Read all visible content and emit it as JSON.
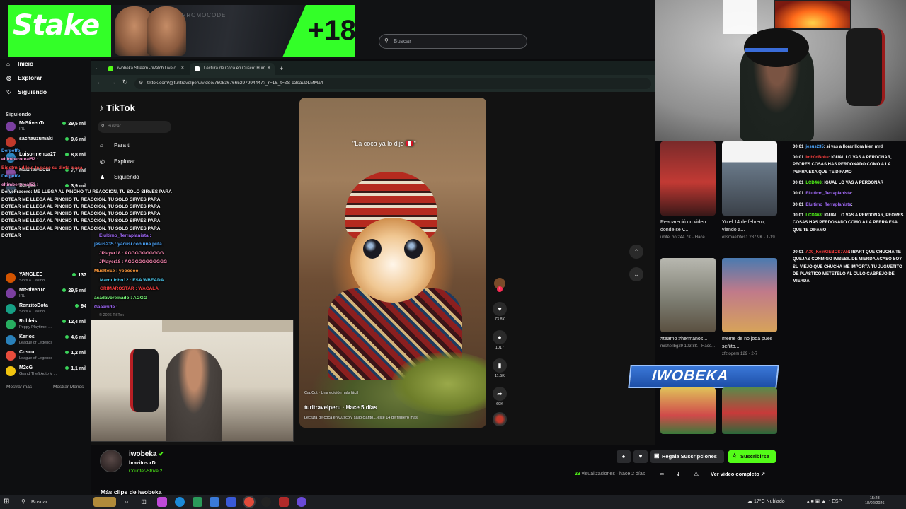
{
  "header": {
    "search_placeholder": "Buscar"
  },
  "banner": {
    "brand": "Stake",
    "promo": "PROMOCODE",
    "age": "+18"
  },
  "sidebar": {
    "nav": [
      "Inicio",
      "Explorar",
      "Siguiendo"
    ],
    "section_title": "Siguiendo",
    "channels": [
      {
        "name": "MrStivenTc",
        "game": "IRL",
        "viewers": "29,5 mil",
        "color": "#7b3fa0"
      },
      {
        "name": "sachauzumaki",
        "game": "",
        "viewers": "9,6 mil",
        "color": "#c0392b"
      },
      {
        "name": "Luisormenoa27",
        "game": "",
        "viewers": "8,8 mil",
        "color": "#2e86c1"
      },
      {
        "name": "MatthewDota",
        "game": "",
        "viewers": "7,7 mil",
        "color": "#884ea0"
      },
      {
        "name": "Bergas",
        "game": "",
        "viewers": "3,9 mil",
        "color": "#34495e"
      },
      {
        "name": "YANGLEE",
        "game": "Slots & Casino",
        "viewers": "137",
        "color": "#d35400"
      },
      {
        "name": "MrStivenTc",
        "game": "IRL",
        "viewers": "29,5 mil",
        "color": "#7b3fa0"
      },
      {
        "name": "RenzitoDota",
        "game": "Slots & Casino",
        "viewers": "94",
        "color": "#16a085"
      },
      {
        "name": "Robleis",
        "game": "Peppy Playtime: ...",
        "viewers": "12,4 mil",
        "color": "#27ae60"
      },
      {
        "name": "Kerios",
        "game": "League of Legends",
        "viewers": "4,6 mil",
        "color": "#2980b9"
      },
      {
        "name": "Coscu",
        "game": "League of Legends",
        "viewers": "1,2 mil",
        "color": "#e74c3c"
      },
      {
        "name": "M2cG",
        "game": "Grand Theft Auto V ...",
        "viewers": "1,1 mil",
        "color": "#f1c40f"
      }
    ],
    "show_more": "Mostrar más",
    "show_less": "Mostrar Menos"
  },
  "overlay_chat": [
    {
      "text": "Derpeffe",
      "color": "#4ea8ff"
    },
    {
      "text": "eltimberoreal52 :",
      "color": "#ff9cd8"
    },
    {
      "text": "Bigetrn : dile q te pase su dieta maca",
      "color": "#ff4a4a"
    },
    {
      "text": "Derpeffe",
      "color": "#4ea8ff"
    },
    {
      "text": "eltimberoreal52 :",
      "color": "#ff9cd8"
    },
    {
      "text": "DeiVeFracero: ME LLEGA AL PINCHO TU REACCION, TU SOLO SIRVES PARA",
      "color": "#ffffff"
    },
    {
      "text": "DOTEAR  ME LLEGA AL PINCHO TU REACCION, TU SOLO SIRVES PARA",
      "color": "#ffffff"
    },
    {
      "text": "DOTEAR  ME LLEGA AL PINCHO TU REACCION, TU SOLO SIRVES PARA",
      "color": "#ffffff"
    },
    {
      "text": "DOTEAR  ME LLEGA AL PINCHO TU REACCION, TU SOLO SIRVES PARA",
      "color": "#ffffff"
    },
    {
      "text": "DOTEAR  ME LLEGA AL PINCHO TU REACCION, TU SOLO SIRVES PARA",
      "color": "#ffffff"
    },
    {
      "text": "DOTEAR  ME LLEGA AL PINCHO TU REACCION, TU SOLO SIRVES PARA",
      "color": "#ffffff"
    },
    {
      "text": "DOTEAR",
      "color": "#ffffff"
    },
    {
      "text": "Elultimo_Terraplanista :",
      "color": "#a66cff"
    },
    {
      "text": "jesus235 : yacusi con una puta",
      "color": "#4ea8ff"
    },
    {
      "text": "JPlayer18 : AGGGGGGGGGG",
      "color": "#ff8ab6"
    },
    {
      "text": "JPlayer18 : AGGGGGGGGGGG",
      "color": "#ff8ab6"
    },
    {
      "text": "MueReEe : yoooooo",
      "color": "#ff9a3c"
    },
    {
      "text": "Marquinho12 : ESA WBEADA",
      "color": "#4ed8ff"
    },
    {
      "text": "GRIMAROSTAR : WACALA",
      "color": "#ff3f3f"
    },
    {
      "text": "acadavoreinado : AGGG",
      "color": "#7cff7c"
    },
    {
      "text": "Gaaanide :",
      "color": "#a66cff"
    }
  ],
  "browser": {
    "tabs": [
      {
        "label": "iwobeka Stream - Watch Live o...",
        "fav": "#53fc18"
      },
      {
        "label": "Lectura de Coca en Cusco: Hum",
        "fav": "#ffffff"
      }
    ],
    "url": "tiktok.com/@turitravelperu/video/7605367665297994447?_r=1&_t=ZS-93sauDLMMa4"
  },
  "tiktok": {
    "logo": "TikTok",
    "search_placeholder": "Buscar",
    "nav": [
      "Para ti",
      "Explorar",
      "Siguiendo"
    ],
    "copyright": "© 2026 TikTok",
    "video": {
      "caption": "\"La coca ya lo dijo 🇵🇪\"",
      "credit": "CapCut · Una edición más fácil",
      "user": "turitravelperu · Hace 5 días",
      "description": "Lectura de coca en Cusco y salió clarito... este 14 de febrero   más"
    },
    "actions": [
      {
        "icon": "♥",
        "count": "73.8K",
        "name": "like"
      },
      {
        "icon": "●",
        "count": "1017",
        "name": "comment"
      },
      {
        "icon": "▮",
        "count": "11.5K",
        "name": "save"
      },
      {
        "icon": "➦",
        "count": "69K",
        "name": "share"
      }
    ],
    "related": [
      {
        "title": "Reapareció un video donde se v...",
        "meta": "unitel.bo  244.7K · Hace..."
      },
      {
        "title": "Yo el 14 de febrero, viendo a...",
        "meta": "elismaelotes1  287.9K · 1-19"
      },
      {
        "title": "#teamo #hermanos...",
        "meta": "mishellbg29  103.8K · Hace..."
      },
      {
        "title": "meme de no joda pues señito...",
        "meta": "zfztogem  129 · 2-7"
      }
    ]
  },
  "stream": {
    "name": "iwobeka",
    "title": "brazitos xD",
    "game": "Counter-Strike 2",
    "gift_label": "Regala Suscripciones",
    "subscribe_label": "Suscribirse",
    "views_count": "23",
    "views_rest": "visualizaciones · hace 2 días",
    "full_video": "Ver video completo",
    "more_clips": "Más clips de iwobeka",
    "overlay_logo": "IWOBEKA"
  },
  "right_chat": [
    {
      "ts": "00:01",
      "user": "jesus235",
      "ucolor": "#4ea8ff",
      "text": ": si vas a llorar llora bien mrd"
    },
    {
      "ts": "00:01",
      "user": "Imb0dBoke",
      "ucolor": "#ff3f3f",
      "text": ": IGUAL LO VAS A PERDONAR, PEORES COSAS HAS PERDONADO COMO A LA PERRA ESA QUE TE DIFAMO"
    },
    {
      "ts": "00:01",
      "user": "LCD468",
      "ucolor": "#53fc18",
      "text": ": IGUAL LO VAS A PERDONAR"
    },
    {
      "ts": "00:01",
      "user": "Elultimo_Terraplanista",
      "ucolor": "#a66cff",
      "text": ": "
    },
    {
      "ts": "00:01",
      "user": "Elultimo_Terraplanista",
      "ucolor": "#a66cff",
      "text": ": "
    },
    {
      "ts": "00:01",
      "user": "LCD468",
      "ucolor": "#53fc18",
      "text": ": IGUAL LO VAS A PERDONAR, PEORES COSAS HAS PERDONADO COMO A LA PERRA ESA QUE TE DIFAMO"
    },
    {
      "ts": "00:01",
      "user": "A30_KeinGEBOS7AN",
      "ucolor": "#ff3f3f",
      "text": ": IBART QUE CHUCHA TE QUEJAS CONMIGO IMBESIL DE MIERDA ACASO SOY SU VIEJO QUE CHUCHA ME IMPORTA TU JUGUETITO DE PLASTICO METETELO AL CULO CABREJO DE MIERDA"
    }
  ],
  "taskbar": {
    "search": "Buscar",
    "weather": "17°C  Nublado",
    "lang": "ESP",
    "time": "15:28",
    "date": "18/02/2026"
  }
}
